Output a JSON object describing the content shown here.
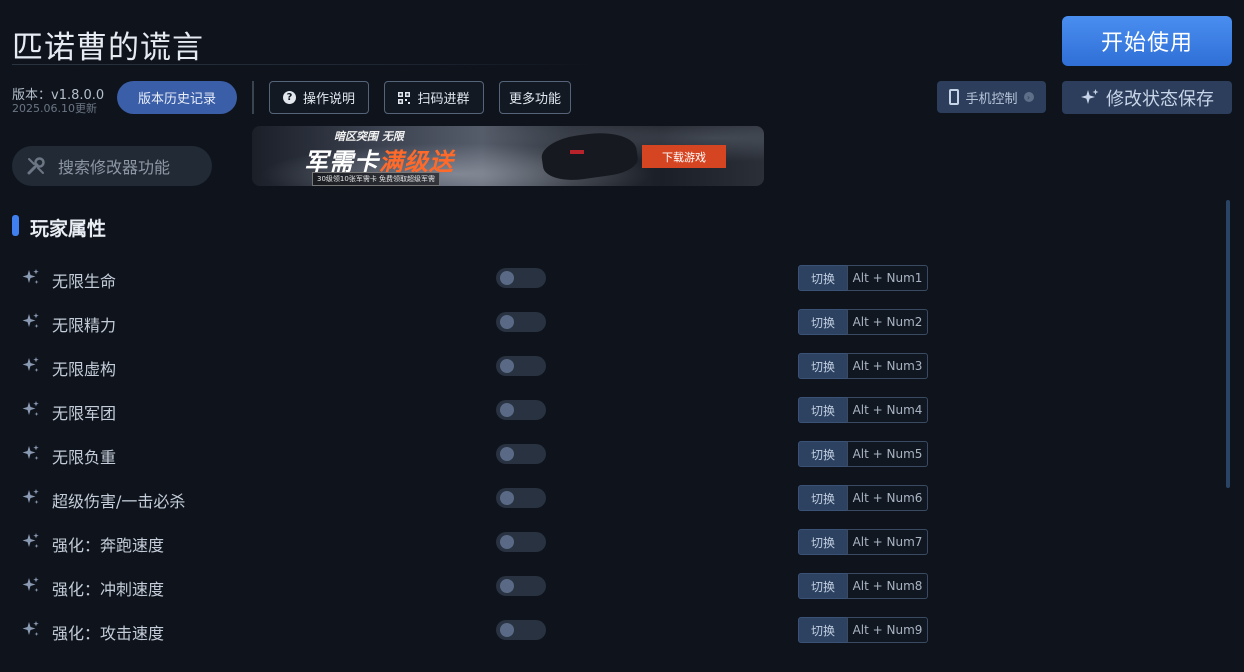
{
  "header": {
    "title": "匹诺曹的谎言",
    "start_label": "开始使用",
    "version": "版本：v1.8.0.0",
    "version_date": "2025.06.10更新",
    "history_label": "版本历史记录"
  },
  "toolbar": {
    "help_label": "操作说明",
    "qr_label": "扫码进群",
    "more_label": "更多功能",
    "phone_label": "手机控制",
    "save_label": "修改状态保存"
  },
  "search": {
    "placeholder": "搜索修改器功能"
  },
  "banner": {
    "top_text": "暗区突围 无限",
    "big_text_white": "军需卡",
    "big_text_orange": "满级送",
    "small_text": "30级领10张军需卡 免费领取超级军需",
    "download_label": "下载游戏"
  },
  "section": {
    "title": "玩家属性"
  },
  "cheats": [
    {
      "label": "无限生命",
      "switch_label": "切换",
      "hotkey": "Alt + Num1",
      "enabled": false
    },
    {
      "label": "无限精力",
      "switch_label": "切换",
      "hotkey": "Alt + Num2",
      "enabled": false
    },
    {
      "label": "无限虚构",
      "switch_label": "切换",
      "hotkey": "Alt + Num3",
      "enabled": false
    },
    {
      "label": "无限军团",
      "switch_label": "切换",
      "hotkey": "Alt + Num4",
      "enabled": false
    },
    {
      "label": "无限负重",
      "switch_label": "切换",
      "hotkey": "Alt + Num5",
      "enabled": false
    },
    {
      "label": "超级伤害/一击必杀",
      "switch_label": "切换",
      "hotkey": "Alt + Num6",
      "enabled": false
    },
    {
      "label": "强化：奔跑速度",
      "switch_label": "切换",
      "hotkey": "Alt + Num7",
      "enabled": false
    },
    {
      "label": "强化：冲刺速度",
      "switch_label": "切换",
      "hotkey": "Alt + Num8",
      "enabled": false
    },
    {
      "label": "强化：攻击速度",
      "switch_label": "切换",
      "hotkey": "Alt + Num9",
      "enabled": false
    }
  ],
  "icons": {
    "sparkle": "sparkle-icon",
    "wrench": "wrench-icon",
    "help": "question-circle-icon",
    "qr": "qr-code-icon",
    "phone": "phone-icon"
  },
  "colors": {
    "accent": "#3f7ff0",
    "start_button": "#3a80ea",
    "background": "#0f141c",
    "banner_cta": "#d64522"
  }
}
